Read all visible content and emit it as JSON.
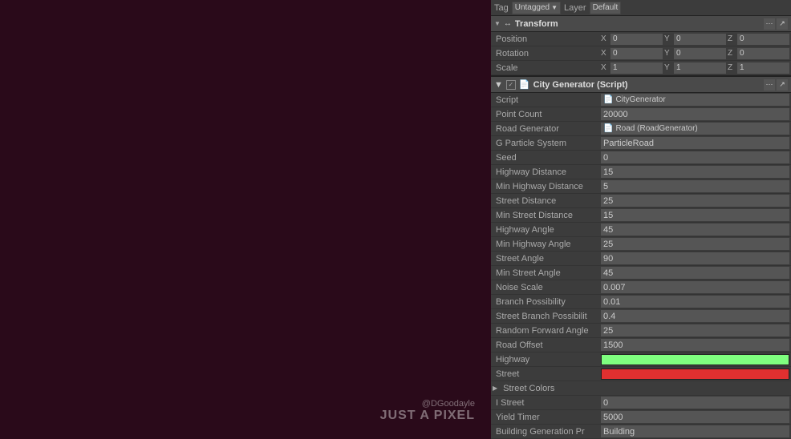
{
  "left": {
    "watermark_handle": "@DGoodayle",
    "watermark_tagline": "JUST A PIXEL"
  },
  "tag_bar": {
    "tag_label": "Tag",
    "tag_value": "Untagged",
    "layer_label": "Layer",
    "layer_value": "Default"
  },
  "transform": {
    "section_title": "Transform",
    "position_label": "Position",
    "rotation_label": "Rotation",
    "scale_label": "Scale",
    "pos_x": "0",
    "pos_y": "0",
    "pos_z": "0",
    "rot_x": "0",
    "rot_y": "0",
    "rot_z": "0",
    "scale_x": "1",
    "scale_y": "1",
    "scale_z": "1"
  },
  "city_generator": {
    "section_title": "City Generator (Script)",
    "script_label": "Script",
    "script_value": "CityGenerator",
    "point_count_label": "Point Count",
    "point_count_value": "20000",
    "road_gen_label": "Road Generator",
    "road_gen_value": "Road (RoadGenerator)",
    "g_particle_label": "G Particle System",
    "g_particle_value": "ParticleRoad",
    "seed_label": "Seed",
    "seed_value": "0",
    "highway_dist_label": "Highway Distance",
    "highway_dist_value": "15",
    "min_highway_dist_label": "Min Highway Distance",
    "min_highway_dist_value": "5",
    "street_dist_label": "Street Distance",
    "street_dist_value": "25",
    "min_street_dist_label": "Min Street Distance",
    "min_street_dist_value": "15",
    "highway_angle_label": "Highway Angle",
    "highway_angle_value": "45",
    "min_highway_angle_label": "Min Highway Angle",
    "min_highway_angle_value": "25",
    "street_angle_label": "Street Angle",
    "street_angle_value": "90",
    "min_street_angle_label": "Min Street Angle",
    "min_street_angle_value": "45",
    "noise_scale_label": "Noise Scale",
    "noise_scale_value": "0.007",
    "branch_poss_label": "Branch Possibility",
    "branch_poss_value": "0.01",
    "street_branch_label": "Street Branch Possibilit",
    "street_branch_value": "0.4",
    "random_fwd_label": "Random Forward Angle",
    "random_fwd_value": "25",
    "road_offset_label": "Road Offset",
    "road_offset_value": "1500",
    "highway_label": "Highway",
    "highway_color": "#7fff7f",
    "street_label": "Street",
    "street_color": "#e03030",
    "street_colors_label": "Street Colors",
    "i_street_label": "I Street",
    "i_street_value": "0",
    "yield_timer_label": "Yield Timer",
    "yield_timer_value": "5000",
    "building_gen_label": "Building Generation Pr",
    "building_gen_value": "Building"
  }
}
